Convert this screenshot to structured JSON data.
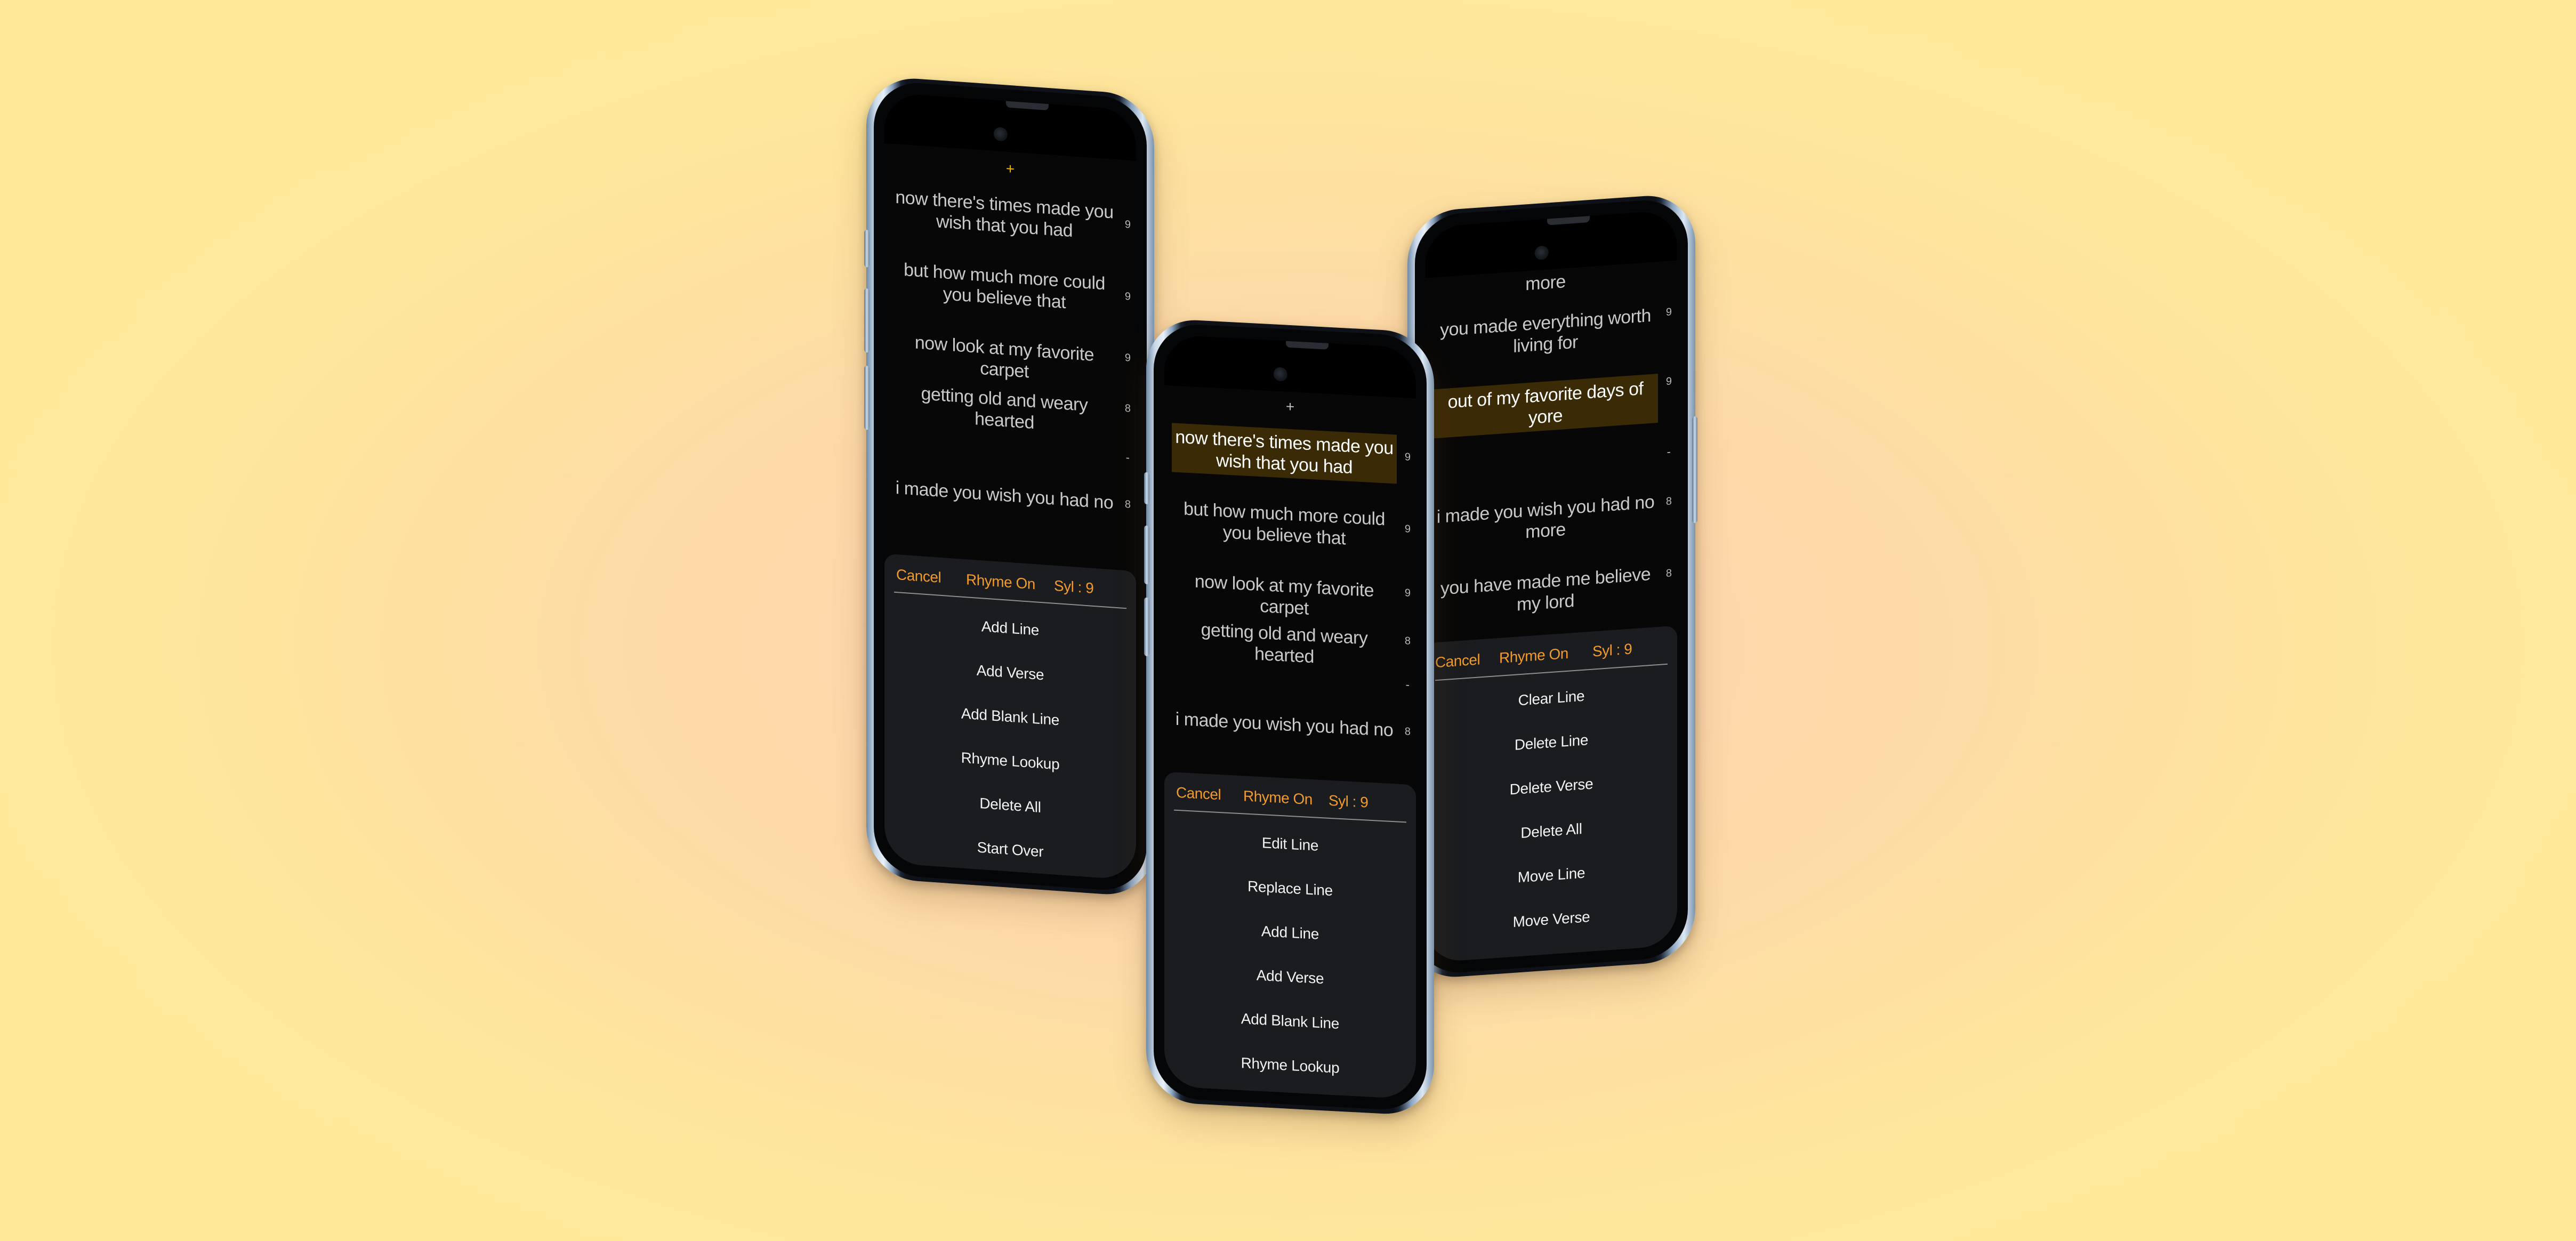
{
  "background": {
    "colors": [
      "#feea98",
      "#fdd0b0"
    ]
  },
  "accent_color": "#f39b2a",
  "highlight_color": "#3a2a06",
  "phones": [
    {
      "id": "left",
      "add_icon": "+",
      "add_icon_color": "#e8b400",
      "lyrics": [
        {
          "text": "now there's times made you wish that you had",
          "syl": "9",
          "highlighted": false
        },
        {
          "text": "but how much more could you believe that",
          "syl": "9",
          "highlighted": false
        },
        {
          "text": "now look at my favorite carpet",
          "syl": "9",
          "highlighted": false
        },
        {
          "text": "getting old and weary hearted",
          "syl": "8",
          "highlighted": false
        },
        {
          "text": "",
          "syl": "-",
          "highlighted": false
        },
        {
          "text": "i made you wish you had no",
          "syl": "8",
          "highlighted": false
        }
      ],
      "sheet": {
        "cancel": "Cancel",
        "rhyme": "Rhyme On",
        "syl": "Syl : 9",
        "items": [
          "Add Line",
          "Add Verse",
          "Add Blank Line",
          "Rhyme Lookup",
          "Delete All",
          "Start Over"
        ]
      }
    },
    {
      "id": "center",
      "add_icon": "+",
      "add_icon_color": "#bdbdbd",
      "lyrics": [
        {
          "text": "now there's times made you wish that you had",
          "syl": "9",
          "highlighted": true
        },
        {
          "text": "but how much more could you believe that",
          "syl": "9",
          "highlighted": false
        },
        {
          "text": "now look at my favorite carpet",
          "syl": "9",
          "highlighted": false
        },
        {
          "text": "getting old and weary hearted",
          "syl": "8",
          "highlighted": false
        },
        {
          "text": "",
          "syl": "-",
          "highlighted": false
        },
        {
          "text": "i made you wish you had no",
          "syl": "8",
          "highlighted": false
        }
      ],
      "sheet": {
        "cancel": "Cancel",
        "rhyme": "Rhyme On",
        "syl": "Syl : 9",
        "items": [
          "Edit Line",
          "Replace Line",
          "Add Line",
          "Add Verse",
          "Add Blank Line",
          "Rhyme Lookup"
        ]
      }
    },
    {
      "id": "right",
      "lyrics": [
        {
          "text": "more",
          "syl": "",
          "highlighted": false
        },
        {
          "text": "you made everything worth living for",
          "syl": "9",
          "highlighted": false
        },
        {
          "text": "out of my favorite days of yore",
          "syl": "9",
          "highlighted": true
        },
        {
          "text": "",
          "syl": "-",
          "highlighted": false
        },
        {
          "text": "i made you wish you had no more",
          "syl": "8",
          "highlighted": false
        },
        {
          "text": "you have made me believe my lord",
          "syl": "8",
          "highlighted": false
        }
      ],
      "sheet": {
        "cancel": "Cancel",
        "rhyme": "Rhyme On",
        "syl": "Syl : 9",
        "items": [
          "Clear Line",
          "Delete Line",
          "Delete Verse",
          "Delete All",
          "Move Line",
          "Move Verse"
        ]
      }
    }
  ]
}
